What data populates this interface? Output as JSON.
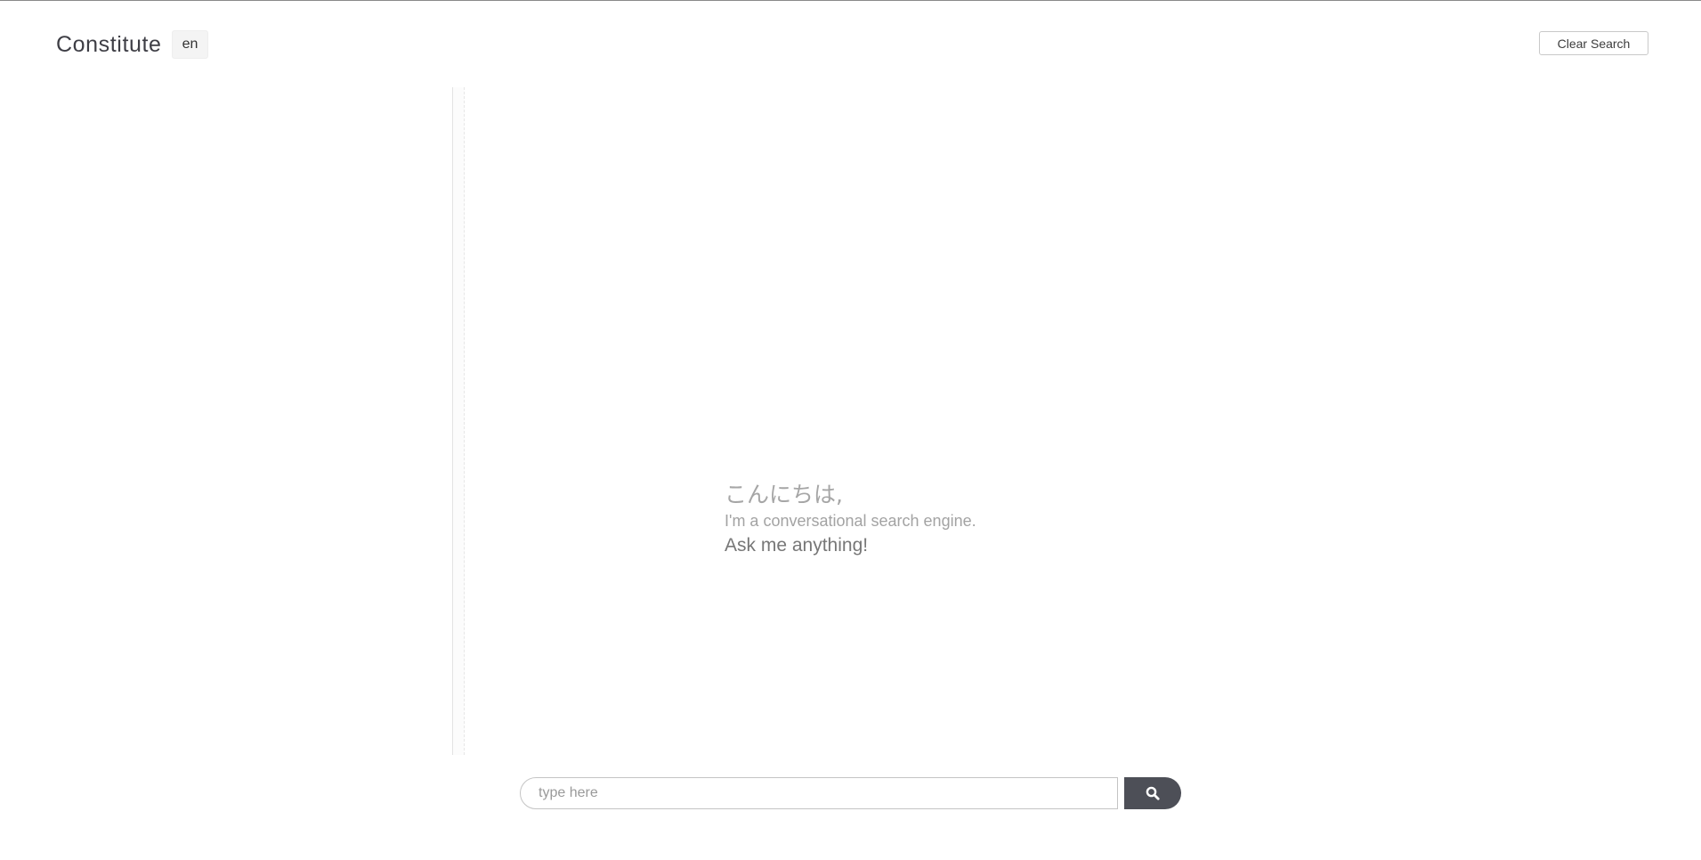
{
  "header": {
    "brand": "Constitute",
    "language": "en",
    "clear_label": "Clear Search"
  },
  "greeting": {
    "hello": "こんにちは,",
    "subtitle": "I'm a conversational search engine.",
    "cta": "Ask me anything!"
  },
  "search": {
    "placeholder": "type here",
    "value": "",
    "button_icon": "search-icon"
  },
  "colors": {
    "search_button": "#4d4f57",
    "top_rule": "#8a8a8a"
  }
}
